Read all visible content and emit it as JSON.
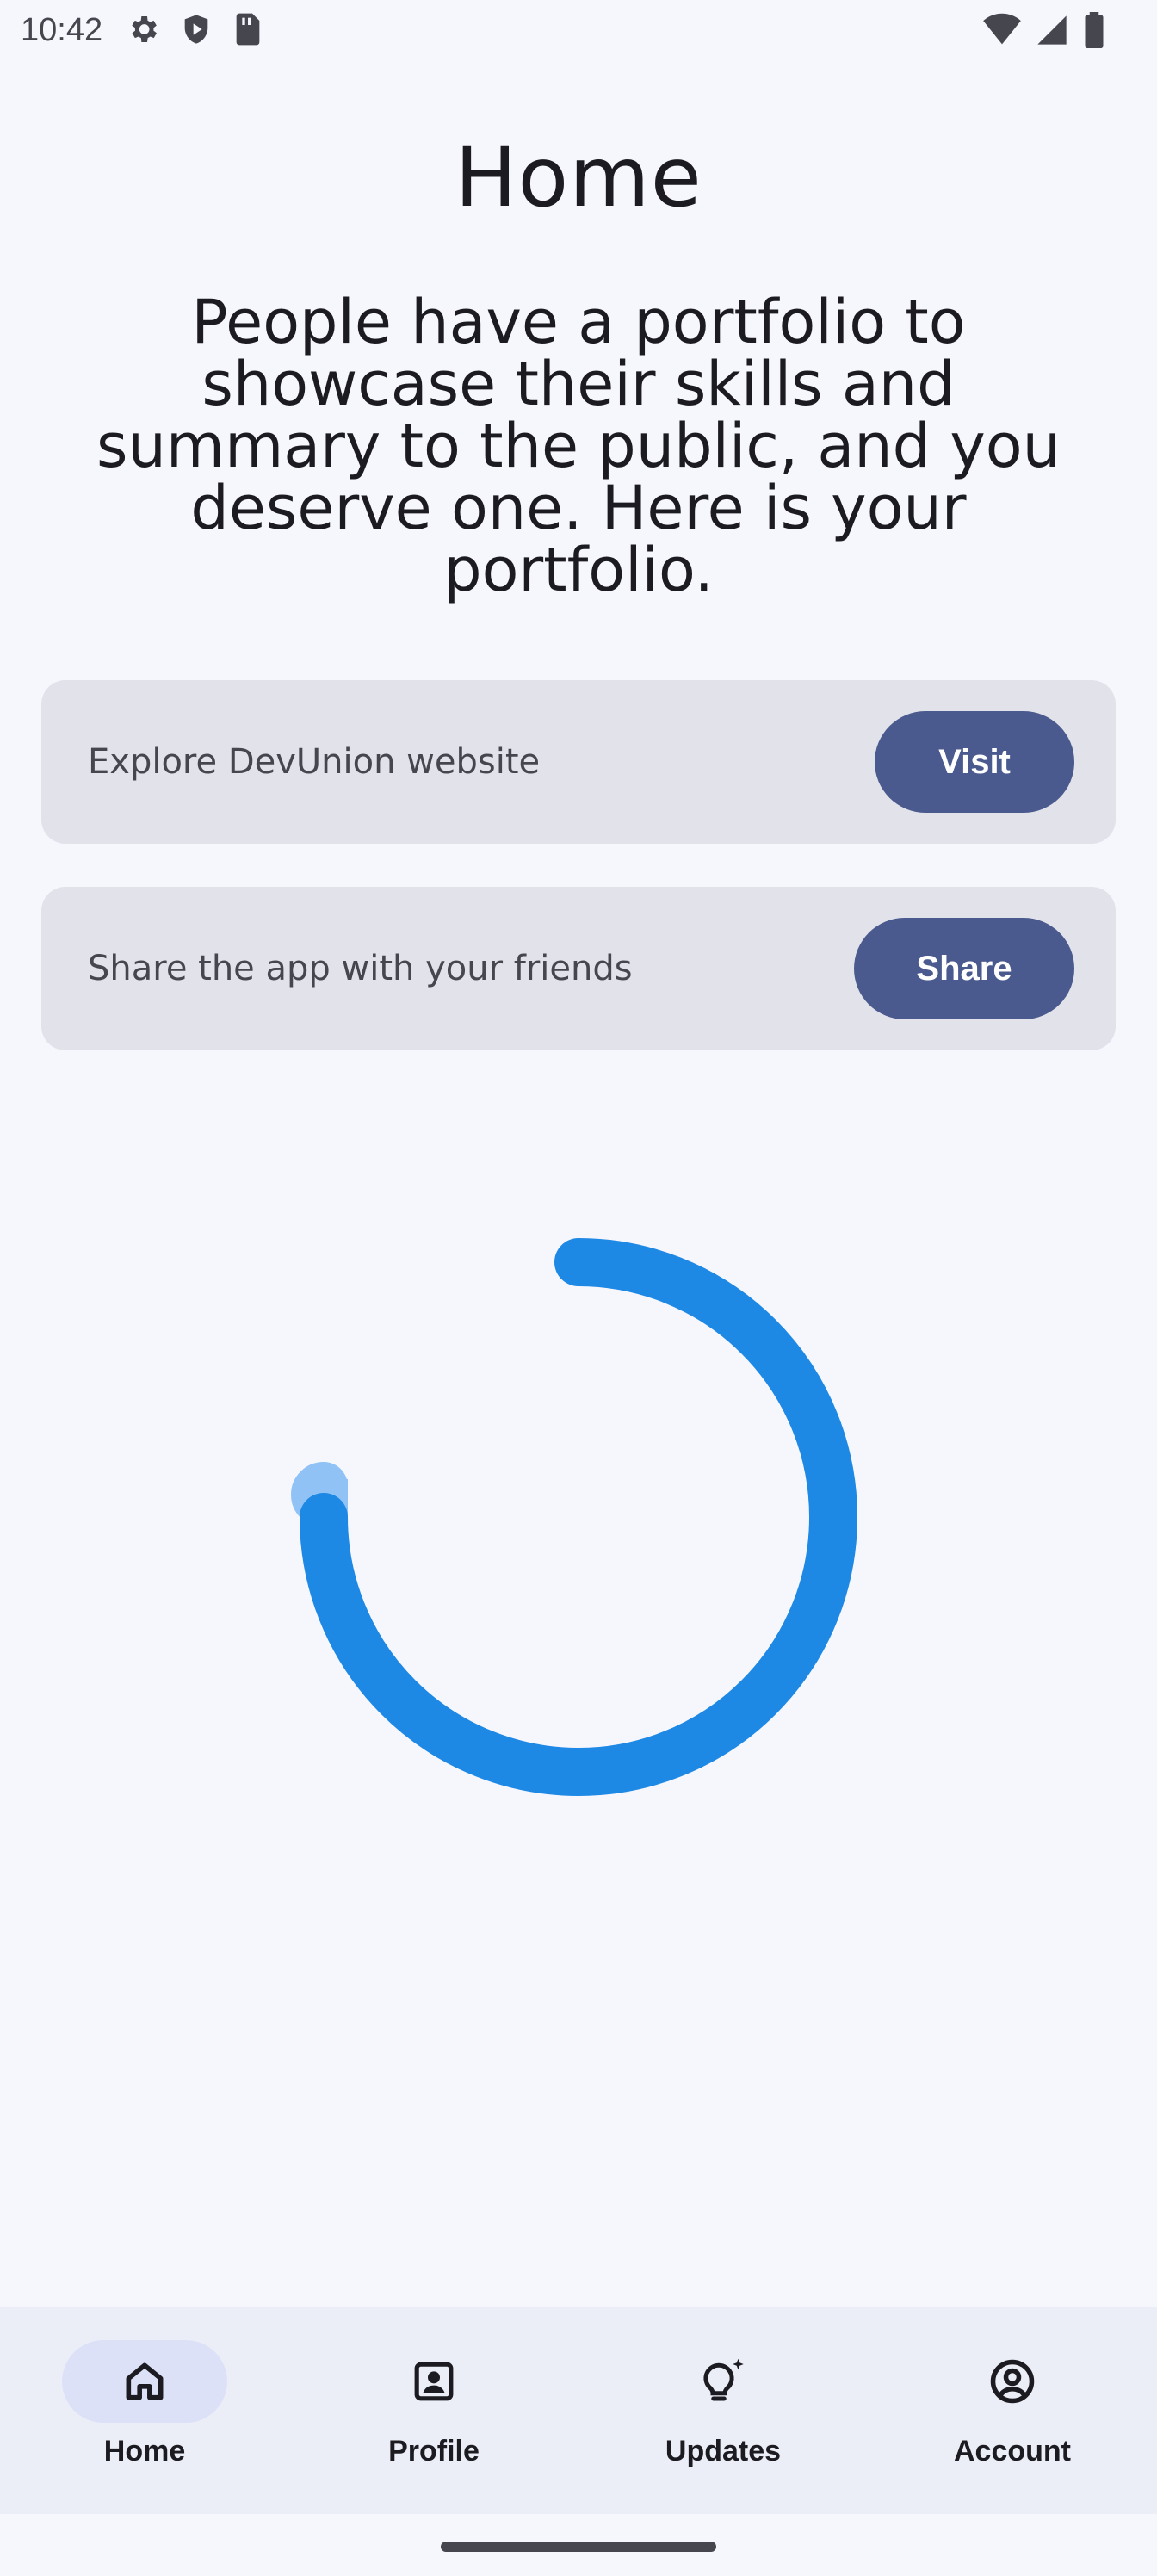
{
  "status_bar": {
    "time": "10:42",
    "left_icons": [
      "settings-icon",
      "shield-icon",
      "sim-card-icon"
    ],
    "right_icons": [
      "wifi-icon",
      "signal-icon",
      "battery-icon"
    ]
  },
  "page": {
    "title": "Home",
    "intro": "People have a portfolio to showcase their skills and summary to the public, and you deserve one. Here is your portfolio."
  },
  "cards": [
    {
      "text": "Explore DevUnion website",
      "button": "Visit"
    },
    {
      "text": "Share the app with your friends",
      "button": "Share"
    }
  ],
  "loading_indicator": {
    "color": "#1e88e5",
    "track_color": "#90c2f5"
  },
  "bottom_nav": {
    "items": [
      {
        "label": "Home",
        "icon": "home-icon",
        "active": true
      },
      {
        "label": "Profile",
        "icon": "profile-icon",
        "active": false
      },
      {
        "label": "Updates",
        "icon": "lightbulb-icon",
        "active": false
      },
      {
        "label": "Account",
        "icon": "account-icon",
        "active": false
      }
    ]
  },
  "colors": {
    "background": "#f6f7fd",
    "card": "#e2e2ea",
    "button": "#4a5a8e",
    "nav_background": "#eceef7",
    "nav_active_pill": "#dde1f8"
  }
}
